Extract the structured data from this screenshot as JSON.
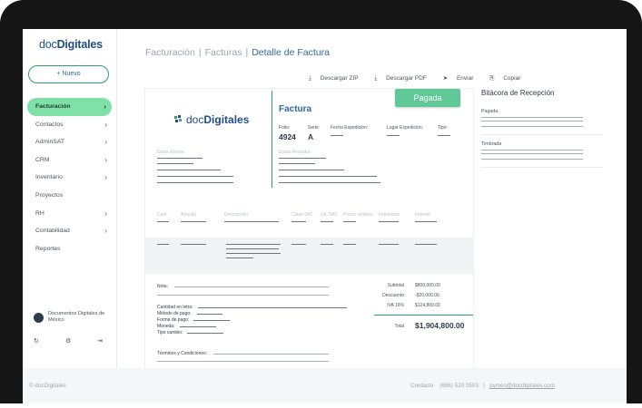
{
  "sidebar": {
    "logo_prefix": "doc",
    "logo_bold": "Digitales",
    "new_button": "+ Nuevo",
    "items": [
      {
        "label": "Facturación",
        "chevron": true,
        "active": true
      },
      {
        "label": "Contactos",
        "chevron": true
      },
      {
        "label": "AdminSAT",
        "chevron": true
      },
      {
        "label": "CRM",
        "chevron": true
      },
      {
        "label": "Inventario",
        "chevron": true
      },
      {
        "label": "Proyectos",
        "chevron": false
      },
      {
        "label": "RH",
        "chevron": true
      },
      {
        "label": "Contabilidad",
        "chevron": true
      },
      {
        "label": "Reportes",
        "chevron": false
      }
    ],
    "org_name": "Documentos Digitales de México"
  },
  "breadcrumb": {
    "first": "Facturación",
    "second": "Facturas",
    "current": "Detalle de Factura",
    "separator": "|"
  },
  "actions": {
    "zip": "Descargar ZIP",
    "pdf": "Descargar PDF",
    "send": "Enviar",
    "copy": "Copiar"
  },
  "invoice": {
    "status": "Pagada",
    "logo_prefix": "doc",
    "logo_bold": "Digitales",
    "title": "Factura",
    "folio_label": "Folio:",
    "folio": "4924",
    "serie_label": "Serie:",
    "serie": "A",
    "fecha_label": "Fecha Expedición:",
    "lugar_label": "Lugar Expedición:",
    "tipo_label": "Tipo:",
    "emisor_label": "Datos Emisor",
    "receptor_label": "Datos Receptor",
    "columns": [
      "Cant.",
      "Artículo",
      "Descripción",
      "Clave SAT",
      "Ud. SAT",
      "Precio Unitario",
      "Impuestos",
      "Importe"
    ],
    "nota_label": "Nota:",
    "letra_label": "Cantidad en letra:",
    "metodo_label": "Método de pago:",
    "forma_label": "Forma de pago:",
    "moneda_label": "Moneda:",
    "tipo_cambio_label": "Tipo cambio:",
    "terminos_label": "Términos y Condiciones:",
    "subtotal_label": "Subtotal",
    "subtotal": "$800,000.00",
    "descuento_label": "Descuento",
    "descuento": "-$20,000.00",
    "iva_label": "IVA 16%",
    "iva": "$124,800.00",
    "total_label": "Total",
    "total": "$1,904,800.00"
  },
  "bitacora": {
    "title": "Bitácora de Recepción",
    "paid": "Pagada",
    "stamped": "Timbrada"
  },
  "footer": {
    "copyright": "© docDigitales",
    "contact_label": "Contacto",
    "phone": "(686) 520 0503",
    "separator": "|",
    "email": "pymes@docdigitales.com"
  },
  "colors": {
    "brand_blue": "#1e4f86",
    "accent_green": "#7fe0a8",
    "paid_green": "#5fc896",
    "bezel": "#151515"
  }
}
